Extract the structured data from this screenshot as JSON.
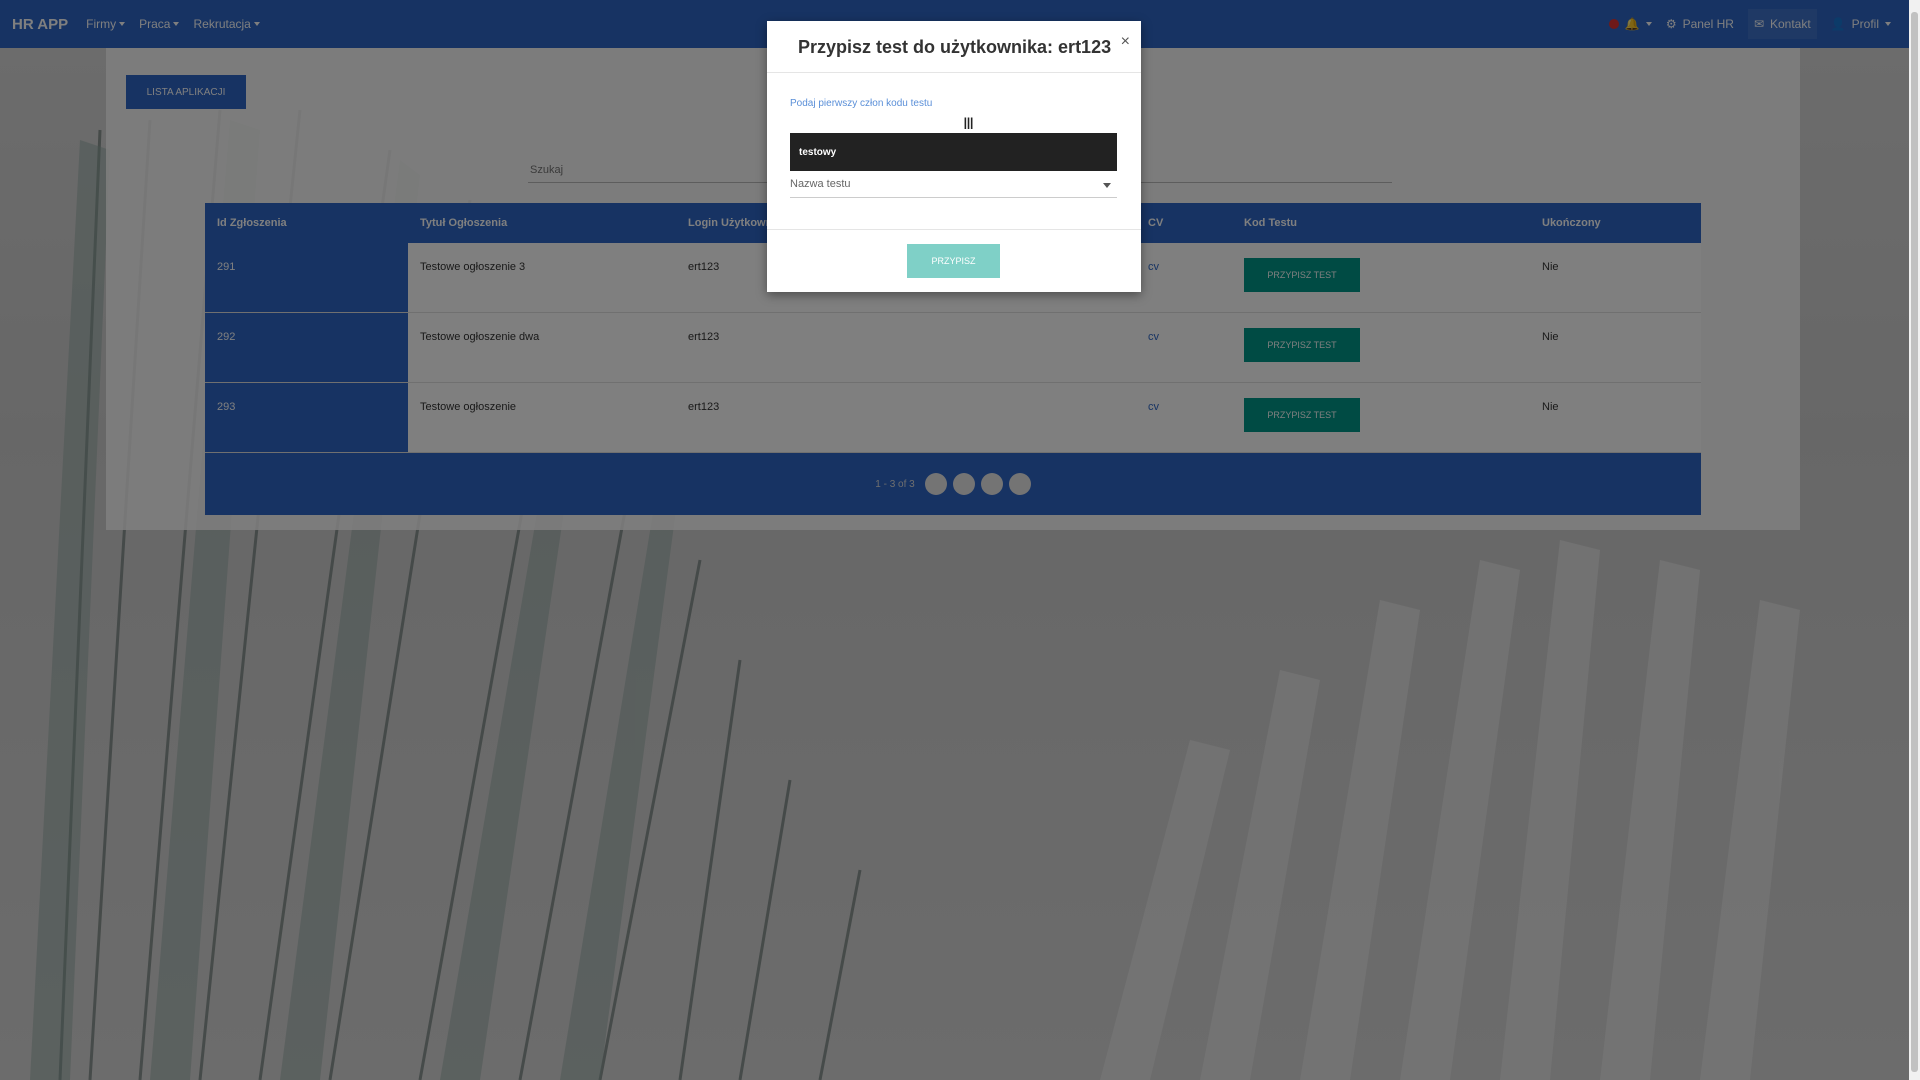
{
  "app": {
    "brand": "HR APP"
  },
  "nav": {
    "left": [
      {
        "label": "Firmy"
      },
      {
        "label": "Praca"
      },
      {
        "label": "Rekrutacja"
      }
    ],
    "right": {
      "notifications_badge": "!",
      "panel_hr": "Panel HR",
      "kontakt": "Kontakt",
      "profil": "Profil"
    }
  },
  "page": {
    "lista_button": "LISTA APLIKACJI",
    "search_placeholder": "Szukaj"
  },
  "table": {
    "headers": [
      "Id Zgłoszenia",
      "Tytuł Ogłoszenia",
      "Login Użytkownika",
      "CV",
      "Kod Testu",
      "Ukończony"
    ],
    "rows": [
      {
        "id": "291",
        "title": "Testowe ogłoszenie 3",
        "login": "ert123",
        "cv": "cv",
        "action": "PRZYPISZ TEST",
        "done": "Nie"
      },
      {
        "id": "292",
        "title": "Testowe ogłoszenie dwa",
        "login": "ert123",
        "cv": "cv",
        "action": "PRZYPISZ TEST",
        "done": "Nie"
      },
      {
        "id": "293",
        "title": "Testowe ogłoszenie",
        "login": "ert123",
        "cv": "cv",
        "action": "PRZYPISZ TEST",
        "done": "Nie"
      }
    ],
    "footer_info": "1 - 3 of 3"
  },
  "modal": {
    "title": "Przypisz test do użytkownika: ert123",
    "close": "×",
    "label": "Podaj pierwszy człon kodu testu",
    "input_value": "testowy",
    "select_placeholder": "Nazwa testu",
    "submit": "PRZYPISZ"
  },
  "colors": {
    "navbar": "#2e67c7",
    "accent_teal": "#009688",
    "submit_disabled": "#7fd0c7"
  },
  "icons": [
    "bell-icon",
    "gear-icon",
    "envelope-icon",
    "user-icon",
    "close-icon",
    "text-cursor-icon"
  ]
}
